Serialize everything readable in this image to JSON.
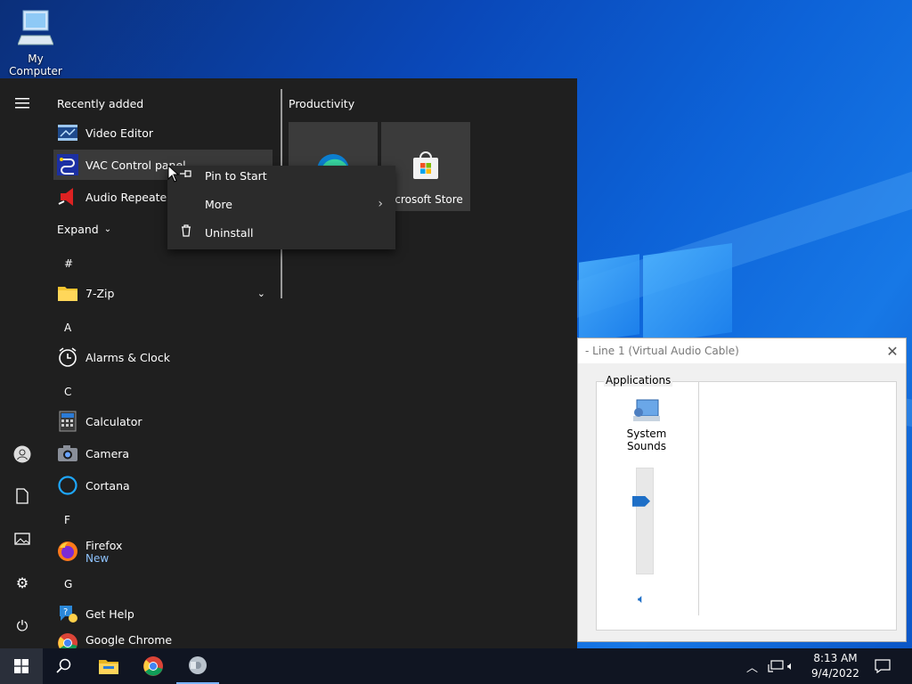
{
  "desktop": {
    "icons": [
      {
        "label": "My Computer",
        "icon": "computer-icon"
      }
    ]
  },
  "dialog": {
    "title": "- Line 1 (Virtual Audio Cable)",
    "group_label": "Applications",
    "app_label": "System Sounds",
    "volume_percent": 70
  },
  "start_menu": {
    "recently_added_title": "Recently added",
    "recent": [
      {
        "name": "Video Editor",
        "icon": "video-editor-icon"
      },
      {
        "name": "VAC Control panel",
        "icon": "vac-cable-icon"
      },
      {
        "name": "Audio Repeater (I",
        "icon": "audio-repeater-icon"
      }
    ],
    "expand_label": "Expand",
    "groups": [
      {
        "letter": "#",
        "apps": [
          {
            "name": "7-Zip",
            "icon": "folder-icon",
            "expandable": true
          }
        ]
      },
      {
        "letter": "A",
        "apps": [
          {
            "name": "Alarms & Clock",
            "icon": "alarm-clock-icon"
          }
        ]
      },
      {
        "letter": "C",
        "apps": [
          {
            "name": "Calculator",
            "icon": "calculator-icon"
          },
          {
            "name": "Camera",
            "icon": "camera-icon"
          },
          {
            "name": "Cortana",
            "icon": "cortana-icon"
          }
        ]
      },
      {
        "letter": "F",
        "apps": [
          {
            "name": "Firefox",
            "sub": "New",
            "icon": "firefox-icon"
          }
        ]
      },
      {
        "letter": "G",
        "apps": [
          {
            "name": "Get Help",
            "icon": "get-help-icon"
          },
          {
            "name": "Google Chrome",
            "icon": "chrome-icon"
          }
        ]
      }
    ],
    "tiles_title": "Productivity",
    "tiles": [
      {
        "name": "",
        "icon": "edge-icon"
      },
      {
        "name": "icrosoft Store",
        "icon": "store-icon"
      }
    ]
  },
  "context_menu": {
    "items": [
      {
        "label": "Pin to Start",
        "icon": "pin-icon"
      },
      {
        "label": "More",
        "icon": "",
        "submenu": true
      },
      {
        "label": "Uninstall",
        "icon": "trash-icon"
      }
    ]
  },
  "taskbar": {
    "clock_time": "8:13 AM",
    "clock_date": "9/4/2022"
  }
}
